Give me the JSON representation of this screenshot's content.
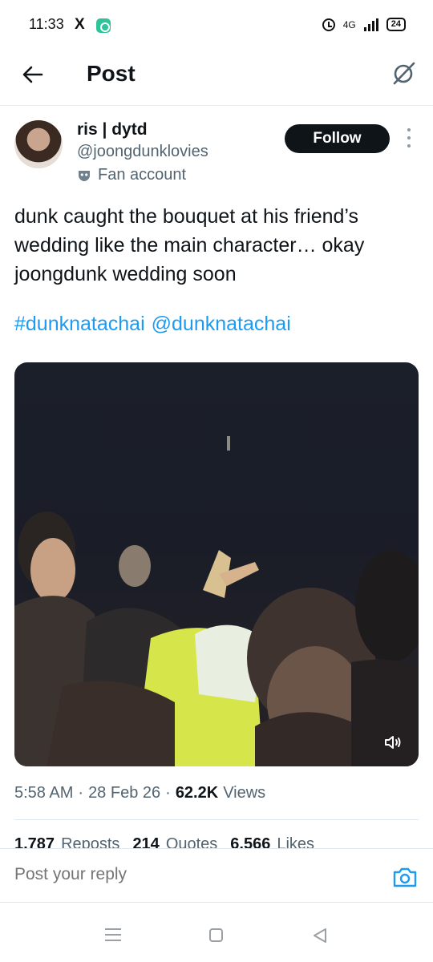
{
  "status_bar": {
    "time": "11:33",
    "network": "4G",
    "battery": "24",
    "x_glyph": "X"
  },
  "header": {
    "title": "Post",
    "back_icon": "arrow-left-icon",
    "grok_icon": "grok-icon"
  },
  "author": {
    "name": "ris | dytd",
    "handle": "@joongdunklovies",
    "label": "Fan account",
    "follow_label": "Follow"
  },
  "post": {
    "text": "dunk caught the bouquet at his friend’s wedding like the main character… okay joongdunk wedding soon",
    "hashtag": "#dunknatachai",
    "mention": "@dunknatachai",
    "time": "5:58 AM",
    "date": "28 Feb 26",
    "separator": "·",
    "views_count": "62.2K",
    "views_label": "Views"
  },
  "stats": {
    "reposts_count": "1,787",
    "reposts_label": "Reposts",
    "quotes_count": "214",
    "quotes_label": "Quotes",
    "likes_count": "6,566",
    "likes_label": "Likes"
  },
  "reply": {
    "placeholder": "Post your reply"
  },
  "colors": {
    "accent": "#1d9bf0",
    "follow_bg": "#0f1419",
    "secondary_text": "#536471"
  }
}
